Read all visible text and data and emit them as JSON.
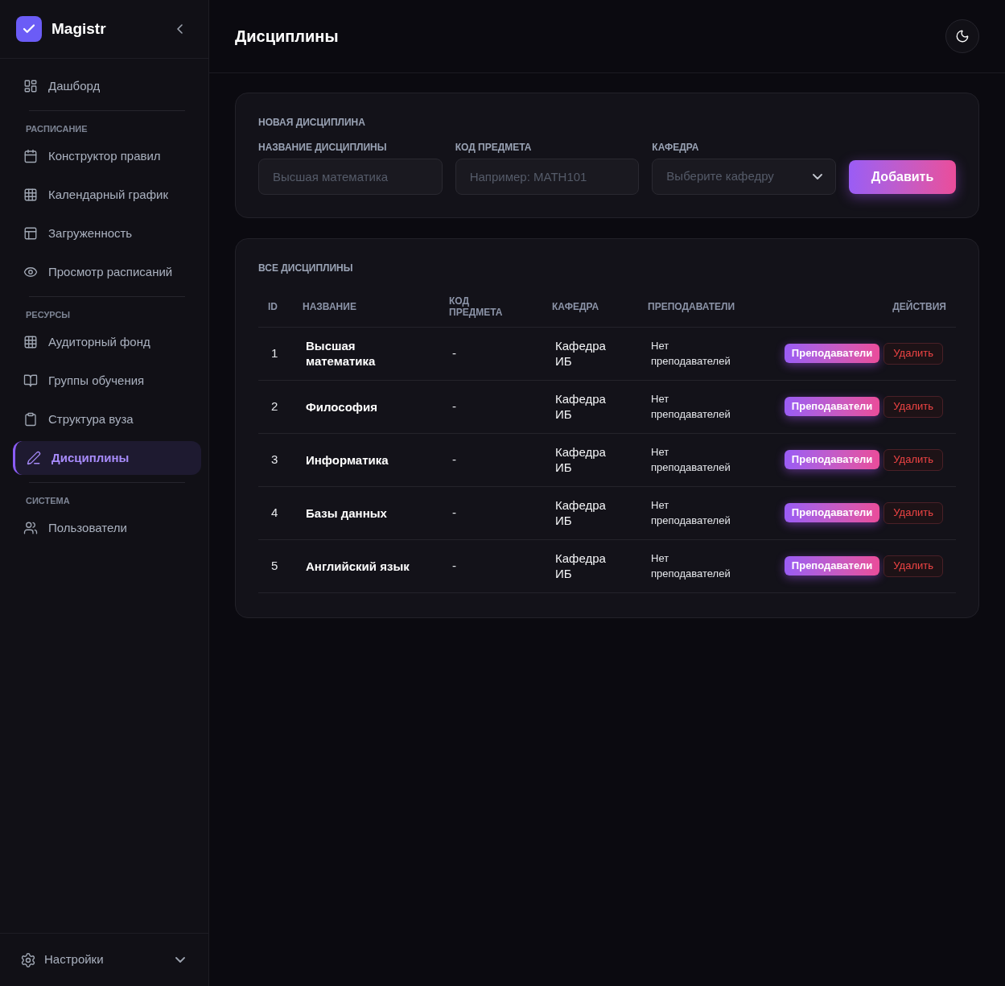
{
  "sidebar": {
    "brand": "Magistr",
    "sections": [
      {
        "items": [
          {
            "label": "Дашборд",
            "selected": false
          }
        ]
      },
      {
        "heading": "РАСПИСАНИЕ",
        "items": [
          {
            "label": "Конструктор правил",
            "selected": false
          },
          {
            "label": "Календарный график",
            "selected": false
          },
          {
            "label": "Загруженность",
            "selected": false
          },
          {
            "label": "Просмотр расписаний",
            "selected": false
          }
        ]
      },
      {
        "heading": "РЕСУРСЫ",
        "items": [
          {
            "label": "Аудиторный фонд",
            "selected": false
          },
          {
            "label": "Группы обучения",
            "selected": false
          },
          {
            "label": "Структура вуза",
            "selected": false
          },
          {
            "label": "Дисциплины",
            "selected": true
          }
        ]
      },
      {
        "heading": "СИСТЕМА",
        "items": [
          {
            "label": "Пользователи",
            "selected": false
          }
        ]
      }
    ],
    "footer": {
      "label": "Настройки"
    }
  },
  "header": {
    "title": "Дисциплины"
  },
  "new_form": {
    "title": "НОВАЯ ДИСЦИПЛИНА",
    "fields": [
      {
        "kind": "text",
        "label": "НАЗВАНИЕ ДИСЦИПЛИНЫ",
        "placeholder": "Высшая математика"
      },
      {
        "kind": "text",
        "label": "КОД ПРЕДМЕТА",
        "placeholder": "Например: MATH101"
      },
      {
        "kind": "select",
        "label": "КАФЕДРА",
        "placeholder": "Выберите кафедру"
      }
    ],
    "submit": "Добавить"
  },
  "table": {
    "title": "ВСЕ ДИСЦИПЛИНЫ",
    "columns": [
      "ID",
      "НАЗВАНИЕ",
      "КОД ПРЕДМЕТА",
      "КАФЕДРА",
      "ПРЕПОДАВАТЕЛИ",
      "ДЕЙСТВИЯ"
    ],
    "rows": [
      {
        "id": "1",
        "name": "Высшая математика",
        "code": "-",
        "department": "Кафедра ИБ",
        "teachers": "Нет преподавателей",
        "actions": [
          {
            "kind": "primary",
            "label": "Преподаватели"
          },
          {
            "kind": "danger",
            "label": "Удалить"
          }
        ]
      },
      {
        "id": "2",
        "name": "Философия",
        "code": "-",
        "department": "Кафедра ИБ",
        "teachers": "Нет преподавателей",
        "actions": [
          {
            "kind": "primary",
            "label": "Преподаватели"
          },
          {
            "kind": "danger",
            "label": "Удалить"
          }
        ]
      },
      {
        "id": "3",
        "name": "Информатика",
        "code": "-",
        "department": "Кафедра ИБ",
        "teachers": "Нет преподавателей",
        "actions": [
          {
            "kind": "primary",
            "label": "Преподаватели"
          },
          {
            "kind": "danger",
            "label": "Удалить"
          }
        ]
      },
      {
        "id": "4",
        "name": "Базы данных",
        "code": "-",
        "department": "Кафедра ИБ",
        "teachers": "Нет преподавателей",
        "actions": [
          {
            "kind": "primary",
            "label": "Преподаватели"
          },
          {
            "kind": "danger",
            "label": "Удалить"
          }
        ]
      },
      {
        "id": "5",
        "name": "Английский язык",
        "code": "-",
        "department": "Кафедра ИБ",
        "teachers": "Нет преподавателей",
        "actions": [
          {
            "kind": "primary",
            "label": "Преподаватели"
          },
          {
            "kind": "danger",
            "label": "Удалить"
          }
        ]
      }
    ]
  }
}
